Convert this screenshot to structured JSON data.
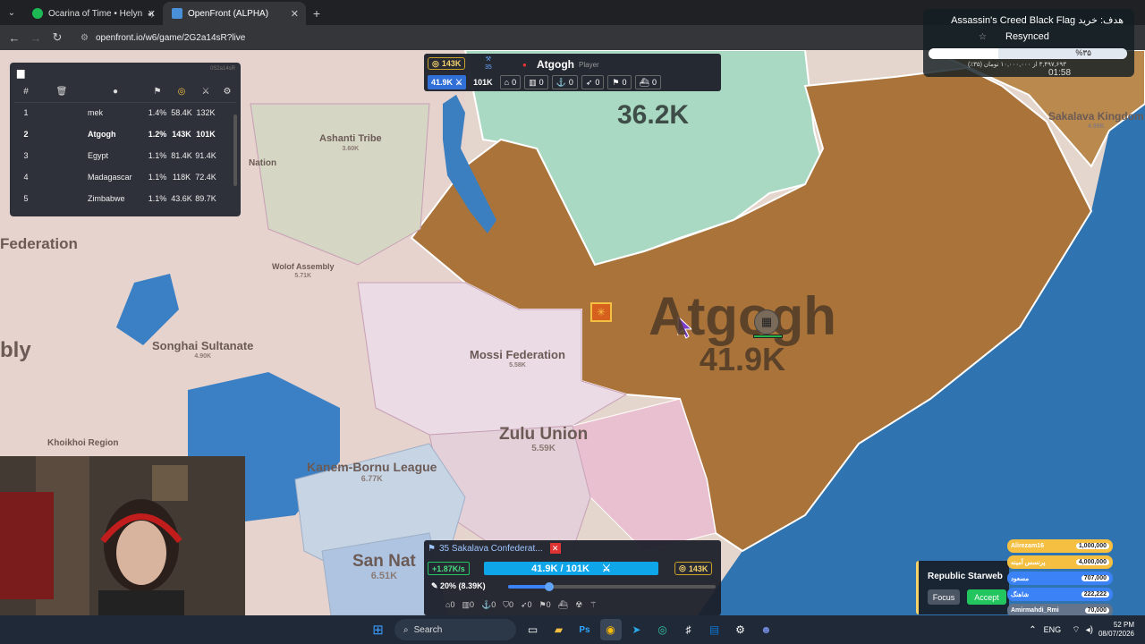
{
  "browser": {
    "tabs": [
      {
        "label": "Ocarina of Time • Helynt, G",
        "active": false
      },
      {
        "label": "OpenFront (ALPHA)",
        "active": true
      }
    ],
    "url": "openfront.io/w6/game/2G2a14sR?live"
  },
  "leaderboard": {
    "game_id": "0S2a14sR",
    "headers": [
      "#"
    ],
    "rows": [
      {
        "rank": "1",
        "name": "mek",
        "pct": "1.4%",
        "gold": "58.4K",
        "troops": "132K",
        "me": false
      },
      {
        "rank": "2",
        "name": "Atgogh",
        "pct": "1.2%",
        "gold": "143K",
        "troops": "101K",
        "me": true
      },
      {
        "rank": "3",
        "name": "Egypt",
        "pct": "1.1%",
        "gold": "81.4K",
        "troops": "91.4K",
        "me": false
      },
      {
        "rank": "4",
        "name": "Madagascar",
        "pct": "1.1%",
        "gold": "118K",
        "troops": "72.4K",
        "me": false
      },
      {
        "rank": "5",
        "name": "Zimbabwe",
        "pct": "1.1%",
        "gold": "43.6K",
        "troops": "89.7K",
        "me": false
      }
    ]
  },
  "player_panel": {
    "gold": "143K",
    "workers_label": "35",
    "name": "Atgogh",
    "role": "Player",
    "troops": "41.9K",
    "max_troops": "101K",
    "units": [
      "0",
      "0",
      "0",
      "0",
      "0",
      "0"
    ]
  },
  "map": {
    "territories": [
      {
        "name": "Atgogh",
        "value": "41.9K"
      },
      {
        "name": "",
        "value": "36.2K"
      },
      {
        "name": "Sakalava Kingdom",
        "value": "4.99K"
      },
      {
        "name": "Ashanti Tribe",
        "value": "3.60K"
      },
      {
        "name": "Nation",
        "value": ""
      },
      {
        "name": "Federation",
        "value": ""
      },
      {
        "name": "Wolof Assembly",
        "value": "5.71K"
      },
      {
        "name": "bly",
        "value": ""
      },
      {
        "name": "Songhai Sultanate",
        "value": "4.90K"
      },
      {
        "name": "Mossi Federation",
        "value": "5.58K"
      },
      {
        "name": "Zulu Union",
        "value": "5.59K"
      },
      {
        "name": "Kanem-Bornu League",
        "value": "6.77K"
      },
      {
        "name": "Khoikhoi Region",
        "value": ""
      },
      {
        "name": "San Nat",
        "value": "6.51K"
      }
    ]
  },
  "bottom_panel": {
    "alliance": "35  Sakalava Confederat...",
    "rate": "+1.87K/s",
    "troops_display": "41.9K / 101K",
    "gold": "143K",
    "attack_ratio": "20% (8.39K)",
    "attack_ratio_value": 0.2,
    "counts": [
      "0",
      "0",
      "0",
      "0",
      "0",
      "0"
    ]
  },
  "overlay": {
    "title": "هدف: خرید Assassin's Creed Black Flag",
    "status": "Resynced",
    "progress_label": "%۳۵",
    "progress": 0.35,
    "progress_sub": "۳,۴۹۷,۶۹۳ از ۱۰,۰۰۰,۰۰۰ تومان (۳۵٪)",
    "time": "01:58"
  },
  "republic": {
    "title": "Republic Starweb",
    "focus": "Focus",
    "accept": "Accept"
  },
  "donations": [
    {
      "name": "Alirezam16",
      "amount": "1,000,000",
      "color": "#f5c042"
    },
    {
      "name": "پرنسس آمینه",
      "amount": "4,000,000",
      "color": "#f5c042"
    },
    {
      "name": "مسعود",
      "amount": "707,000",
      "color": "#3b82f6"
    },
    {
      "name": "شاهنگ",
      "amount": "222,222",
      "color": "#3b82f6"
    },
    {
      "name": "Amirmahdi_Rmi",
      "amount": "70,000",
      "color": "#64748b"
    },
    {
      "name": "farid.h.b",
      "amount": "50,000",
      "color": "#64748b"
    }
  ],
  "taskbar": {
    "search": "Search",
    "lang": "ENG",
    "time": "52 PM",
    "date": "08/07/2026"
  }
}
